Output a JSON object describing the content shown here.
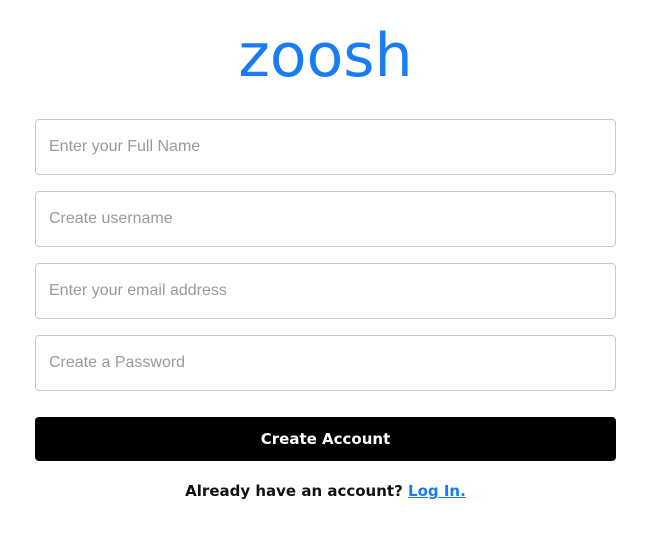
{
  "brand": {
    "name": "zoosh",
    "color": "#1a7cf2"
  },
  "form": {
    "full_name": {
      "placeholder": "Enter your Full Name",
      "value": ""
    },
    "username": {
      "placeholder": "Create username",
      "value": ""
    },
    "email": {
      "placeholder": "Enter your email address",
      "value": ""
    },
    "password": {
      "placeholder": "Create a Password",
      "value": ""
    },
    "submit_label": "Create Account",
    "submit_bg": "#000000",
    "submit_fg": "#ffffff"
  },
  "footer": {
    "prompt": "Already have an account?",
    "link_label": "Log In.",
    "link_color": "#1a7cf2"
  }
}
